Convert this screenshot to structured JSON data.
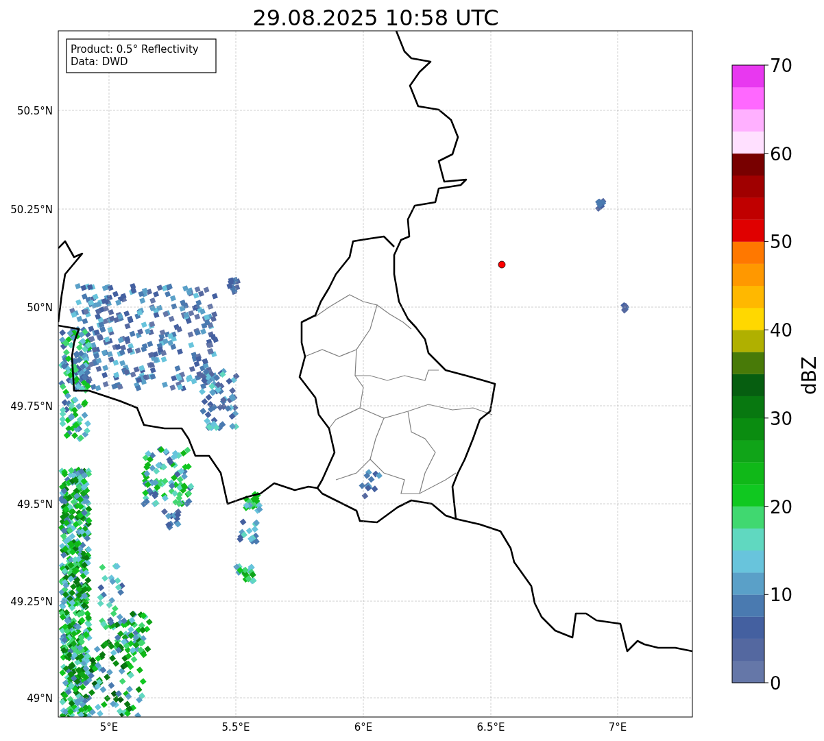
{
  "title": "29.08.2025 10:58 UTC",
  "info_box": [
    "Product: 0.5° Reflectivity",
    "Data: DWD"
  ],
  "map": {
    "xticks": [
      "5°E",
      "5.5°E",
      "6°E",
      "6.5°E",
      "7°E"
    ],
    "yticks": [
      "50.5°N",
      "50.25°N",
      "50°N",
      "49.75°N",
      "49.5°N",
      "49.25°N",
      "49°N"
    ]
  },
  "colorbar": {
    "label": "dBZ",
    "ticks": [
      "70",
      "60",
      "50",
      "40",
      "30",
      "20",
      "10",
      "0"
    ],
    "bands": [
      {
        "color": "#6577a8"
      },
      {
        "color": "#5468a0"
      },
      {
        "color": "#4460a0"
      },
      {
        "color": "#4a7ab0"
      },
      {
        "color": "#5aa0c8"
      },
      {
        "color": "#68c4dc"
      },
      {
        "color": "#60d8c0"
      },
      {
        "color": "#40d870"
      },
      {
        "color": "#10c820"
      },
      {
        "color": "#10b818"
      },
      {
        "color": "#10a418"
      },
      {
        "color": "#0a8c10"
      },
      {
        "color": "#087810"
      },
      {
        "color": "#065e10"
      },
      {
        "color": "#487a08"
      },
      {
        "color": "#b0b000"
      },
      {
        "color": "#ffd800"
      },
      {
        "color": "#ffb800"
      },
      {
        "color": "#ff9800"
      },
      {
        "color": "#ff7800"
      },
      {
        "color": "#e00000"
      },
      {
        "color": "#c00000"
      },
      {
        "color": "#a00000"
      },
      {
        "color": "#780000"
      },
      {
        "color": "#ffe0ff"
      },
      {
        "color": "#ffb0ff"
      },
      {
        "color": "#ff68ff"
      },
      {
        "color": "#e838f0"
      }
    ]
  }
}
